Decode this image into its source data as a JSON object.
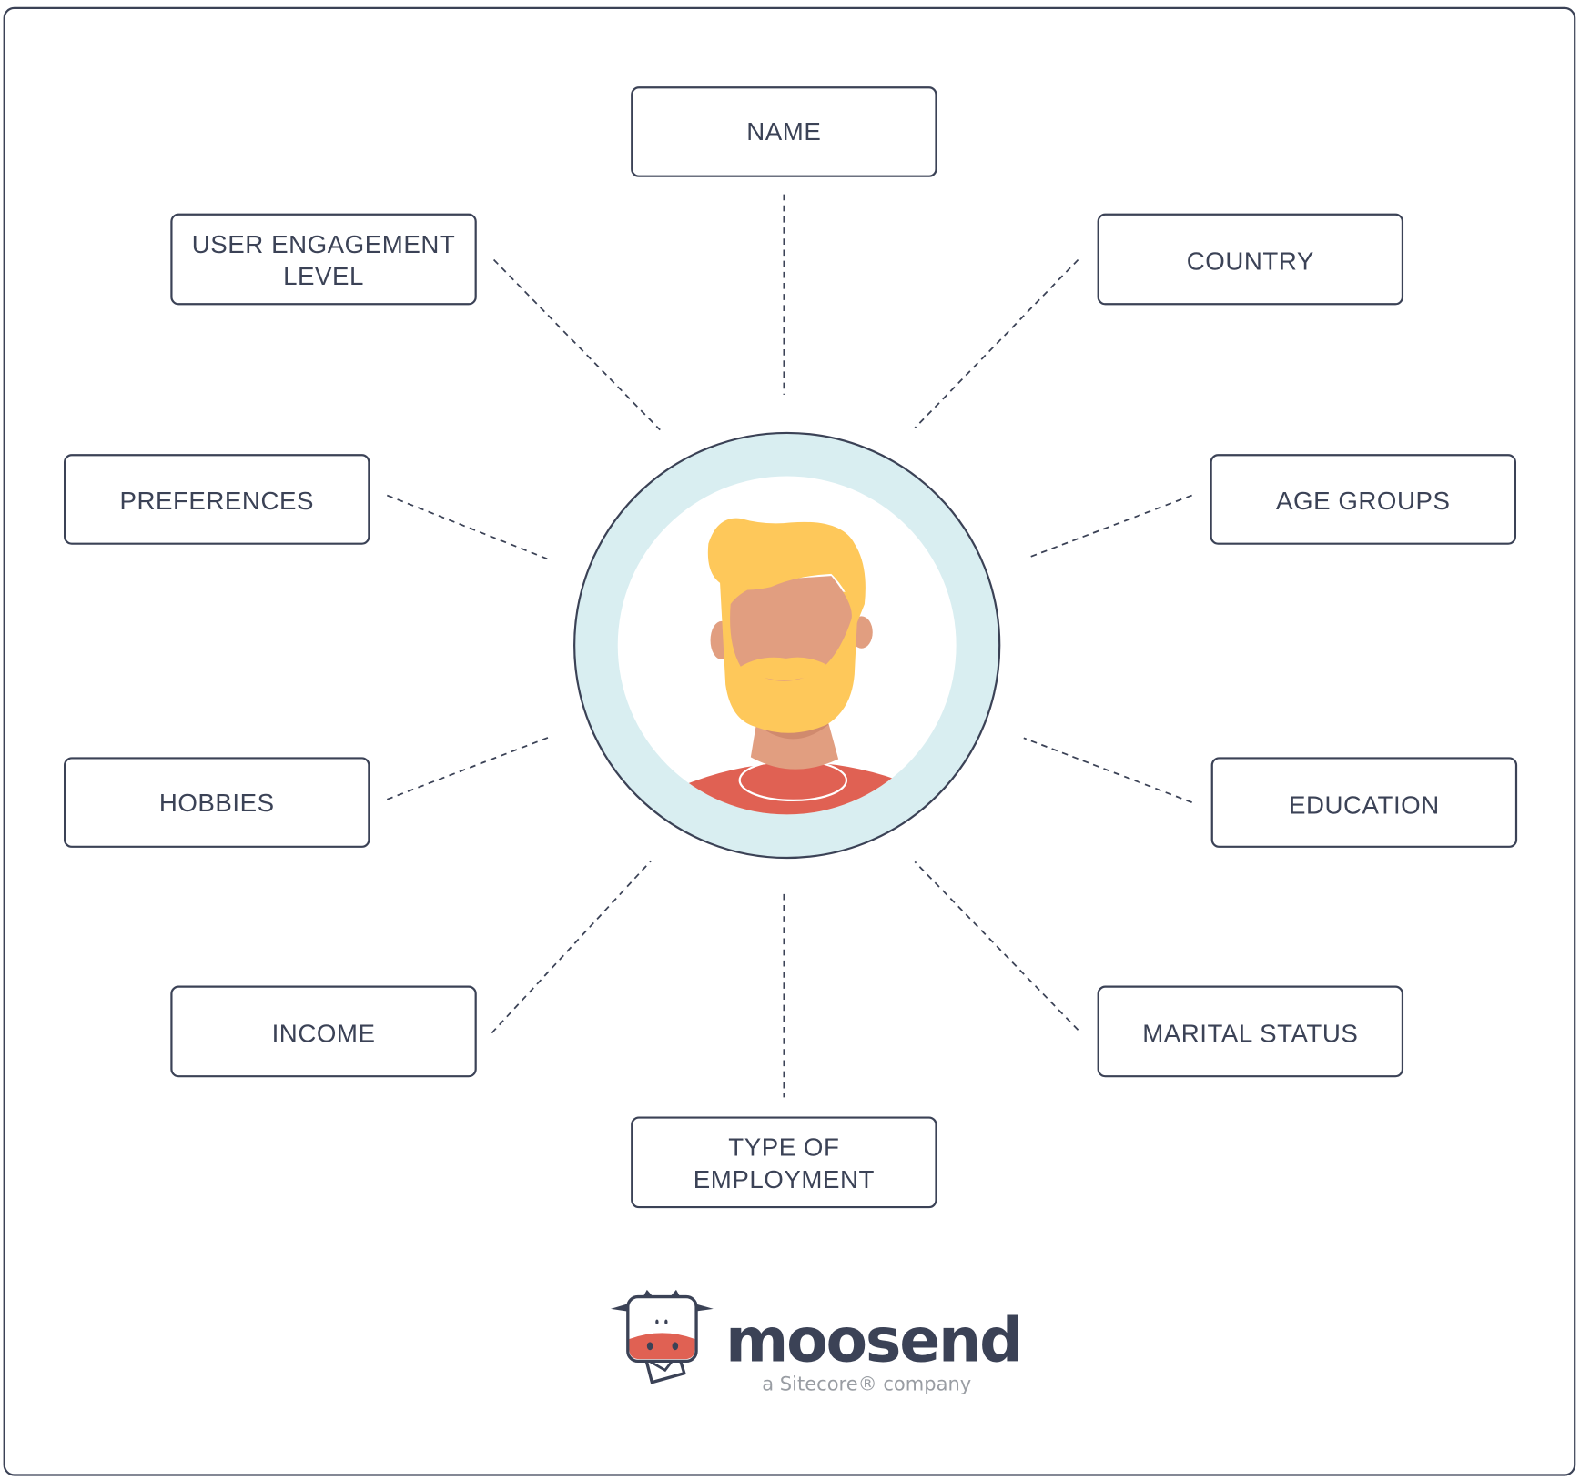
{
  "center": {
    "label": "user-avatar"
  },
  "attributes": [
    {
      "id": "name",
      "lines": [
        "NAME"
      ]
    },
    {
      "id": "user-engagement-level",
      "lines": [
        "USER ENGAGEMENT",
        "LEVEL"
      ]
    },
    {
      "id": "country",
      "lines": [
        "COUNTRY"
      ]
    },
    {
      "id": "preferences",
      "lines": [
        "PREFERENCES"
      ]
    },
    {
      "id": "age-groups",
      "lines": [
        "AGE GROUPS"
      ]
    },
    {
      "id": "hobbies",
      "lines": [
        "HOBBIES"
      ]
    },
    {
      "id": "education",
      "lines": [
        "EDUCATION"
      ]
    },
    {
      "id": "income",
      "lines": [
        "INCOME"
      ]
    },
    {
      "id": "marital-status",
      "lines": [
        "MARITAL STATUS"
      ]
    },
    {
      "id": "type-of-employment",
      "lines": [
        "TYPE OF",
        "EMPLOYMENT"
      ]
    }
  ],
  "logo": {
    "wordmark": "moosend",
    "tagline": "a Sitecore® company"
  },
  "colors": {
    "ink": "#3b4256",
    "ring": "#d9eef1",
    "hair": "#fec85a",
    "skin": "#e19e80",
    "shirt": "#e06153",
    "tagline": "#999da3"
  }
}
